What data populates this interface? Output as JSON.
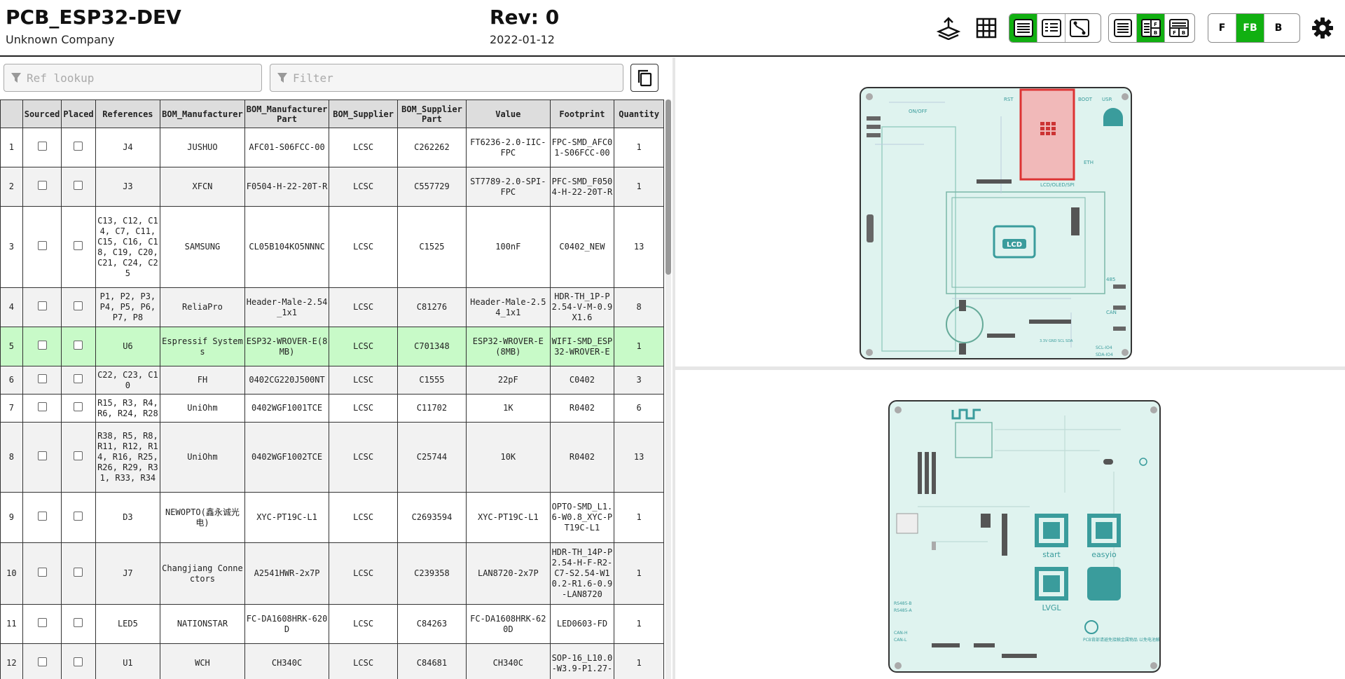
{
  "header": {
    "title": "PCB_ESP32-DEV",
    "company": "Unknown Company",
    "revision": "Rev: 0",
    "date": "2022-01-12"
  },
  "layer_buttons": {
    "front": "F",
    "both": "FB",
    "back": "B"
  },
  "filters": {
    "ref_placeholder": "Ref lookup",
    "filter_placeholder": "Filter"
  },
  "colors": {
    "accent": "#11b011",
    "highlight_row": "#c8fac8",
    "board": "#dff3ef",
    "silk": "#3a9c9c"
  },
  "icons": [
    "upload-layers-icon",
    "grid-icon",
    "bom-left-right-icon",
    "bom-top-bottom-icon",
    "netlist-icon",
    "bom-only-icon",
    "bom-left-drawings-right-icon",
    "bom-top-drawings-bottom-icon",
    "settings-gear-icon",
    "filter-icon",
    "copy-icon"
  ],
  "table": {
    "headers": [
      "",
      "Sourced",
      "Placed",
      "References",
      "BOM_Manufacturer",
      "BOM_Manufacturer Part",
      "BOM_Supplier",
      "BOM_Supplier Part",
      "Value",
      "Footprint",
      "Quantity"
    ],
    "rows": [
      {
        "n": "1",
        "refs": "J4",
        "mfr": "JUSHUO",
        "mpart": "AFC01-S06FCC-00",
        "sup": "LCSC",
        "spart": "C262262",
        "value": "FT6236-2.0-IIC-FPC",
        "fp": "FPC-SMD_AFC01-S06FCC-00",
        "qty": "1"
      },
      {
        "n": "2",
        "refs": "J3",
        "mfr": "XFCN",
        "mpart": "F0504-H-22-20T-R",
        "sup": "LCSC",
        "spart": "C557729",
        "value": "ST7789-2.0-SPI-FPC",
        "fp": "PFC-SMD_F0504-H-22-20T-R",
        "qty": "1"
      },
      {
        "n": "3",
        "refs": "C13, C12, C14, C7, C11, C15, C16, C18, C19, C20, C21, C24, C25",
        "mfr": "SAMSUNG",
        "mpart": "CL05B104KO5NNNC",
        "sup": "LCSC",
        "spart": "C1525",
        "value": "100nF",
        "fp": "C0402_NEW",
        "qty": "13"
      },
      {
        "n": "4",
        "refs": "P1, P2, P3, P4, P5, P6, P7, P8",
        "mfr": "ReliaPro",
        "mpart": "Header-Male-2.54_1x1",
        "sup": "LCSC",
        "spart": "C81276",
        "value": "Header-Male-2.54_1x1",
        "fp": "HDR-TH_1P-P2.54-V-M-0.9X1.6",
        "qty": "8"
      },
      {
        "n": "5",
        "refs": "U6",
        "mfr": "Espressif Systems",
        "mpart": "ESP32-WROVER-E(8MB)",
        "sup": "LCSC",
        "spart": "C701348",
        "value": "ESP32-WROVER-E(8MB)",
        "fp": "WIFI-SMD_ESP32-WROVER-E",
        "qty": "1"
      },
      {
        "n": "6",
        "refs": "C22, C23, C10",
        "mfr": "FH",
        "mpart": "0402CG220J500NT",
        "sup": "LCSC",
        "spart": "C1555",
        "value": "22pF",
        "fp": "C0402",
        "qty": "3"
      },
      {
        "n": "7",
        "refs": "R15, R3, R4, R6, R24, R28",
        "mfr": "UniOhm",
        "mpart": "0402WGF1001TCE",
        "sup": "LCSC",
        "spart": "C11702",
        "value": "1K",
        "fp": "R0402",
        "qty": "6"
      },
      {
        "n": "8",
        "refs": "R38, R5, R8, R11, R12, R14, R16, R25, R26, R29, R31, R33, R34",
        "mfr": "UniOhm",
        "mpart": "0402WGF1002TCE",
        "sup": "LCSC",
        "spart": "C25744",
        "value": "10K",
        "fp": "R0402",
        "qty": "13"
      },
      {
        "n": "9",
        "refs": "D3",
        "mfr": "NEWOPTO(鑫永诚光电)",
        "mpart": "XYC-PT19C-L1",
        "sup": "LCSC",
        "spart": "C2693594",
        "value": "XYC-PT19C-L1",
        "fp": "OPTO-SMD_L1.6-W0.8_XYC-PT19C-L1",
        "qty": "1"
      },
      {
        "n": "10",
        "refs": "J7",
        "mfr": "Changjiang Connectors",
        "mpart": "A2541HWR-2x7P",
        "sup": "LCSC",
        "spart": "C239358",
        "value": "LAN8720-2x7P",
        "fp": "HDR-TH_14P-P2.54-H-F-R2-C7-S2.54-W10.2-R1.6-0.9-LAN8720",
        "qty": "1"
      },
      {
        "n": "11",
        "refs": "LED5",
        "mfr": "NATIONSTAR",
        "mpart": "FC-DA1608HRK-620D",
        "sup": "LCSC",
        "spart": "C84263",
        "value": "FC-DA1608HRK-620D",
        "fp": "LED0603-FD",
        "qty": "1"
      },
      {
        "n": "12",
        "refs": "U1",
        "mfr": "WCH",
        "mpart": "CH340C",
        "sup": "LCSC",
        "spart": "C84681",
        "value": "CH340C",
        "fp": "SOP-16_L10.0-W3.9-P1.27-",
        "qty": "1"
      }
    ]
  },
  "front_board": {
    "labels": [
      "ON/OFF",
      "RST",
      "BOOT",
      "USR",
      "LCD",
      "LCD/OLED/SPI",
      "ETH",
      "485",
      "CAN",
      "SCL-IO4",
      "SDA-IO4",
      "3.3V GND SCL SDA"
    ]
  },
  "back_board": {
    "labels": [
      "start",
      "easyio",
      "LVGL",
      "RS485-B",
      "RS485-A",
      "CAN-H",
      "CAN-L",
      "PCB背部请避免接触金属物品 以免电池触点短路"
    ]
  }
}
